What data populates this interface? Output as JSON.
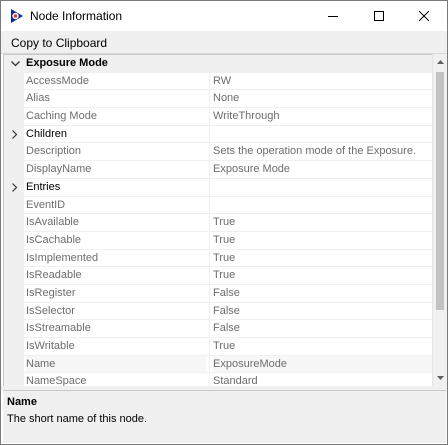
{
  "window": {
    "title": "Node Information",
    "colors": {
      "accent": "#0b2b8f",
      "brand_red": "#e53935"
    },
    "controls": {
      "minimize_icon": "minimize-icon",
      "maximize_icon": "maximize-icon",
      "close_icon": "close-icon"
    }
  },
  "toolbar": {
    "copy_label": "Copy to Clipboard"
  },
  "grid": {
    "category": {
      "label": "Exposure Mode",
      "expanded": true
    },
    "rows": [
      {
        "name": "AccessMode",
        "value": "RW"
      },
      {
        "name": "Alias",
        "value": "None"
      },
      {
        "name": "Caching Mode",
        "value": "WriteThrough"
      },
      {
        "name": "Children",
        "value": "",
        "group": true
      },
      {
        "name": "Description",
        "value": "Sets the operation mode of the Exposure."
      },
      {
        "name": "DisplayName",
        "value": "Exposure Mode"
      },
      {
        "name": "Entries",
        "value": "",
        "group": true
      },
      {
        "name": "EventID",
        "value": ""
      },
      {
        "name": "IsAvailable",
        "value": "True"
      },
      {
        "name": "IsCachable",
        "value": "True"
      },
      {
        "name": "IsImplemented",
        "value": "True"
      },
      {
        "name": "IsReadable",
        "value": "True"
      },
      {
        "name": "IsRegister",
        "value": "False"
      },
      {
        "name": "IsSelector",
        "value": "False"
      },
      {
        "name": "IsStreamable",
        "value": "False"
      },
      {
        "name": "IsWritable",
        "value": "True"
      },
      {
        "name": "Name",
        "value": "ExposureMode",
        "selected": true
      },
      {
        "name": "NameSpace",
        "value": "Standard"
      }
    ]
  },
  "help": {
    "title": "Name",
    "description": "The short name of this node."
  }
}
